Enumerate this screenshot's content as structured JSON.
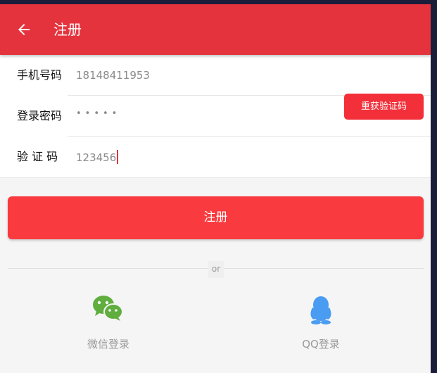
{
  "appbar": {
    "title": "注册",
    "back_icon": "arrow-left-icon"
  },
  "form": {
    "phone": {
      "label": "手机号码",
      "value": "18148411953"
    },
    "password": {
      "label": "登录密码",
      "value": "•••••"
    },
    "code": {
      "label": "验 证 码",
      "value": "123456"
    },
    "resend_label": "重获验证码"
  },
  "register_label": "注册",
  "divider_text": "or",
  "social": {
    "wechat": {
      "label": "微信登录",
      "icon": "wechat-icon",
      "color": "#5fae3e"
    },
    "qq": {
      "label": "QQ登录",
      "icon": "qq-icon",
      "color": "#4a9bf2"
    }
  },
  "colors": {
    "accent": "#e5333d",
    "button": "#f93a3e"
  }
}
